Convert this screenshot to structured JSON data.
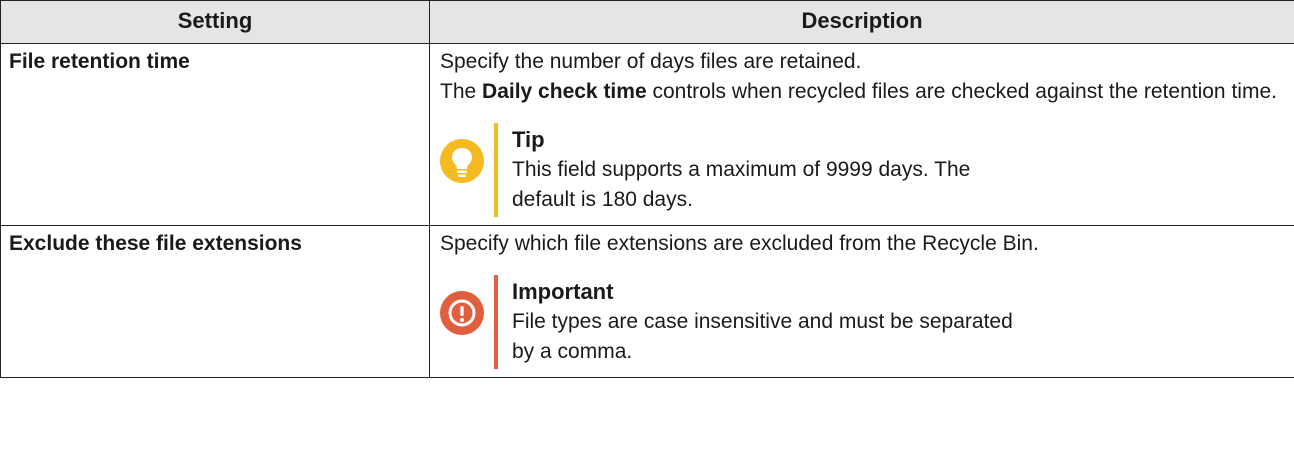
{
  "table": {
    "headers": [
      "Setting",
      "Description"
    ],
    "rows": [
      {
        "setting": "File retention time",
        "description": {
          "line1": "Specify the number of days files are retained.",
          "line2_prefix": "The ",
          "line2_bold": "Daily check time",
          "line2_suffix": " controls when recycled files are checked against the retention time."
        },
        "note": {
          "type": "tip",
          "icon": "lightbulb-icon",
          "color": "#f5b921",
          "title": "Tip",
          "text": "This field supports a maximum of 9999 days. The default is 180 days."
        }
      },
      {
        "setting": "Exclude these file extensions",
        "description": {
          "line1": "Specify which file extensions are excluded from the Recycle Bin."
        },
        "note": {
          "type": "important",
          "icon": "exclamation-icon",
          "color": "#e15f3e",
          "title": "Important",
          "text": "File types are case insensitive and must be separated by a comma."
        }
      }
    ]
  }
}
